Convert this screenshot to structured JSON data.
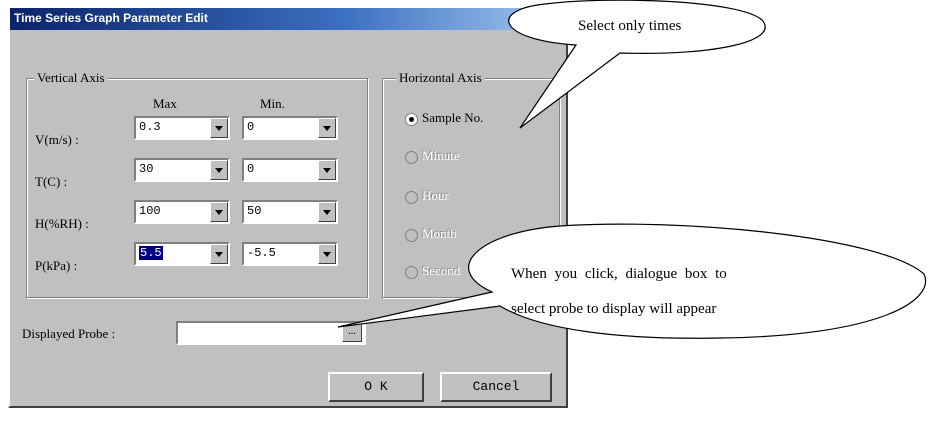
{
  "dialog": {
    "title": "Time Series Graph Parameter Edit",
    "vertical_axis": {
      "label": "Vertical Axis",
      "max_header": "Max",
      "min_header": "Min.",
      "rows": [
        {
          "label": "V(m/s) :",
          "max": "0.3",
          "min": "0"
        },
        {
          "label": "T(C) :",
          "max": "30",
          "min": "0"
        },
        {
          "label": "H(%RH) :",
          "max": "100",
          "min": "50"
        },
        {
          "label": "P(kPa) :",
          "max": "5.5",
          "min": "-5.5"
        }
      ]
    },
    "horizontal_axis": {
      "label": "Horizontal Axis",
      "options": [
        {
          "label": "Sample No.",
          "selected": true,
          "enabled": true
        },
        {
          "label": "Minute",
          "selected": false,
          "enabled": false
        },
        {
          "label": "Hour",
          "selected": false,
          "enabled": false
        },
        {
          "label": "Month",
          "selected": false,
          "enabled": false
        },
        {
          "label": "Second",
          "selected": false,
          "enabled": false
        }
      ]
    },
    "displayed_probe": {
      "label": "Displayed Probe :",
      "value": "",
      "browse_label": "..."
    },
    "ok_label": "O K",
    "cancel_label": "Cancel"
  },
  "callouts": {
    "top": "Select only times",
    "bottom_line1": "When you click, dialogue box to",
    "bottom_line2": "select probe to display will appear"
  },
  "colors": {
    "face": "#c0c0c0",
    "title_start": "#0a246a",
    "title_end": "#a6caf0",
    "selection": "#000080"
  }
}
